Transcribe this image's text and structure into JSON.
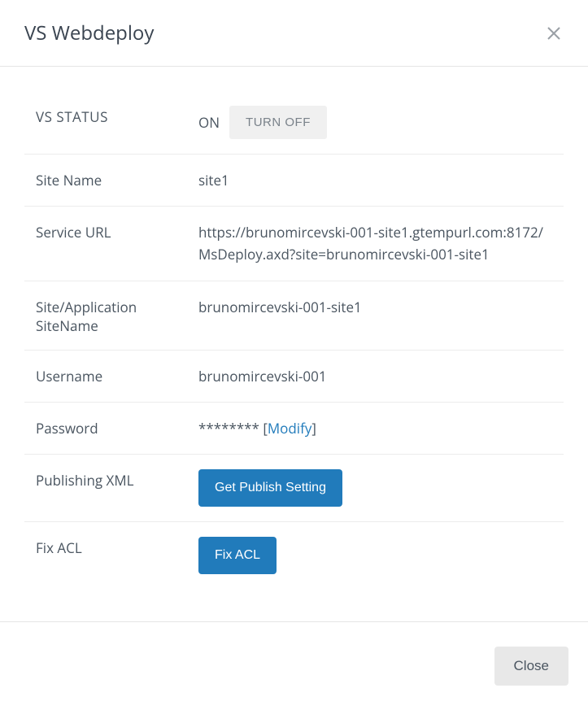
{
  "header": {
    "title": "VS Webdeploy"
  },
  "rows": {
    "vs_status": {
      "label": "VS STATUS",
      "state": "ON",
      "turn_off_button": "TURN OFF"
    },
    "site_name": {
      "label": "Site Name",
      "value": "site1"
    },
    "service_url": {
      "label": "Service URL",
      "value": "https://brunomircevski-001-site1.gtempurl.com:8172/MsDeploy.axd?site=brunomircevski-001-site1"
    },
    "site_app": {
      "label": "Site/Application SiteName",
      "value": "brunomircevski-001-site1"
    },
    "username": {
      "label": "Username",
      "value": "brunomircevski-001"
    },
    "password": {
      "label": "Password",
      "masked": "********",
      "bracket_open": " [",
      "modify_text": "Modify",
      "bracket_close": "]"
    },
    "publishing_xml": {
      "label": "Publishing XML",
      "button": "Get Publish Setting"
    },
    "fix_acl": {
      "label": "Fix ACL",
      "button": "Fix ACL"
    }
  },
  "footer": {
    "close_button": "Close"
  }
}
